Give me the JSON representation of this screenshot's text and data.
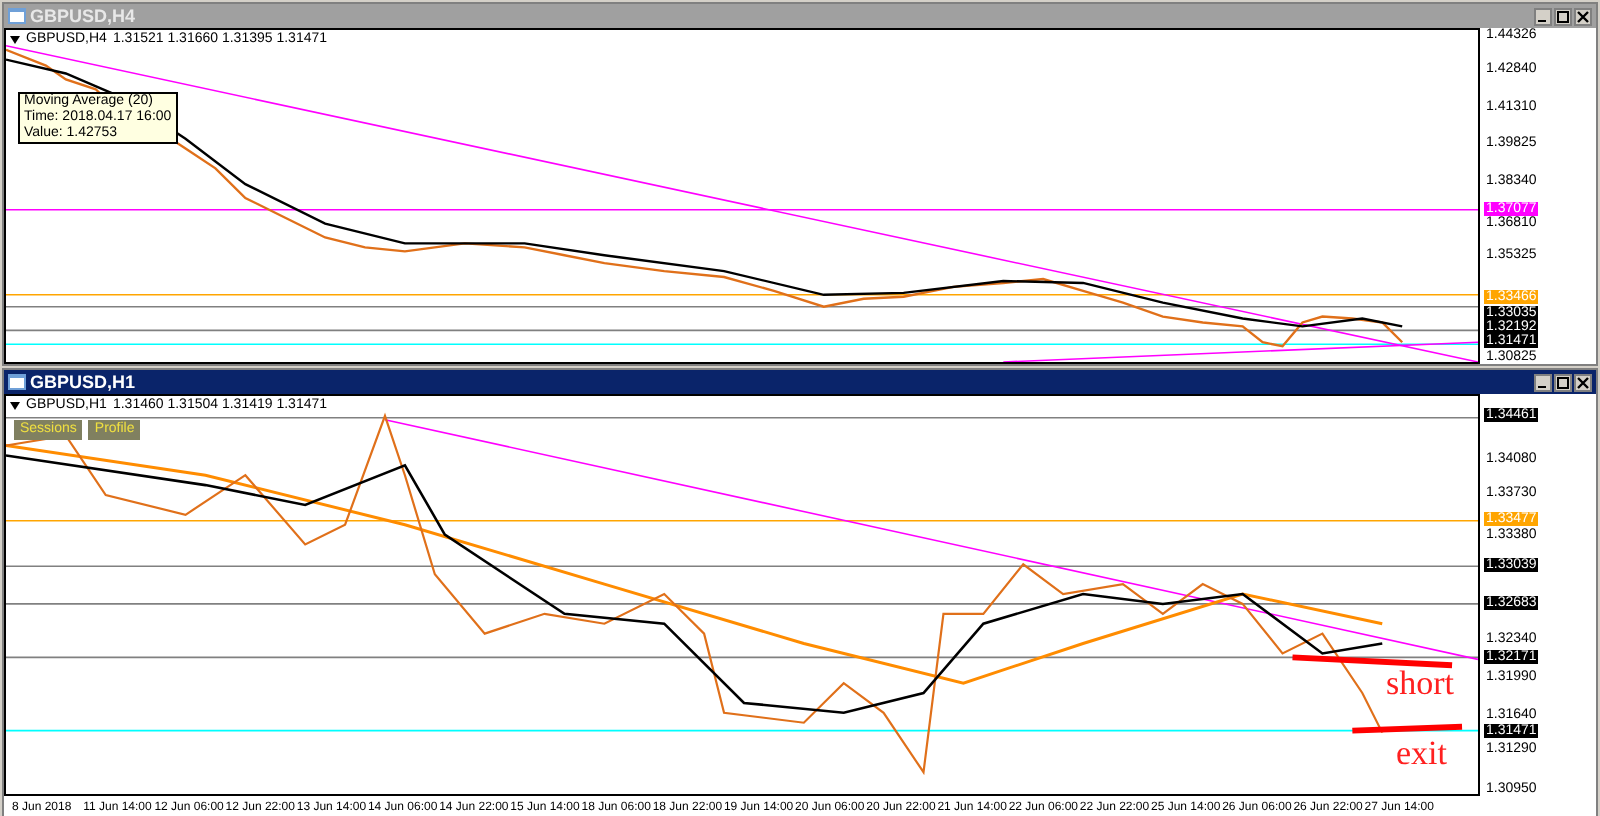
{
  "windows": [
    {
      "title": "GBPUSD,H4",
      "active": false,
      "header": {
        "symbol": "GBPUSD,H4",
        "prices": "1.31521 1.31660 1.31395 1.31471"
      },
      "tooltip": [
        "Moving Average (20)",
        "Time: 2018.04.17 16:00",
        "Value: 1.42753"
      ],
      "price_axis": [
        {
          "label": "1.44326",
          "kind": "tick"
        },
        {
          "label": "1.42840",
          "kind": "tick"
        },
        {
          "label": "1.41310",
          "kind": "tick"
        },
        {
          "label": "1.39825",
          "kind": "tick"
        },
        {
          "label": "1.38340",
          "kind": "tick"
        },
        {
          "label": "1.37077",
          "kind": "tag",
          "color": "#ff00ff"
        },
        {
          "label": "1.36810",
          "kind": "tick"
        },
        {
          "label": "1.35325",
          "kind": "tick"
        },
        {
          "label": "1.33466",
          "kind": "tag",
          "color": "#ffa500"
        },
        {
          "label": "1.33035",
          "kind": "tag",
          "color": "#000000"
        },
        {
          "label": "1.32192",
          "kind": "tag",
          "color": "#000000"
        },
        {
          "label": "1.31471",
          "kind": "tag",
          "color": "#000000"
        },
        {
          "label": "1.30825",
          "kind": "tick"
        }
      ]
    },
    {
      "title": "GBPUSD,H1",
      "active": true,
      "header": {
        "symbol": "GBPUSD,H1",
        "prices": "1.31460 1.31504 1.31419 1.31471"
      },
      "buttons": [
        "Sessions",
        "Profile"
      ],
      "annotations": [
        "short",
        "exit"
      ],
      "price_axis": [
        {
          "label": "1.34461",
          "kind": "tag",
          "color": "#000000"
        },
        {
          "label": "1.34080",
          "kind": "tick"
        },
        {
          "label": "1.33730",
          "kind": "tick"
        },
        {
          "label": "1.33477",
          "kind": "tag",
          "color": "#ffa500"
        },
        {
          "label": "1.33380",
          "kind": "tick"
        },
        {
          "label": "1.33039",
          "kind": "tag",
          "color": "#000000"
        },
        {
          "label": "1.32683",
          "kind": "tag",
          "color": "#000000"
        },
        {
          "label": "1.32340",
          "kind": "tick"
        },
        {
          "label": "1.32171",
          "kind": "tag",
          "color": "#000000"
        },
        {
          "label": "1.31990",
          "kind": "tick"
        },
        {
          "label": "1.31640",
          "kind": "tick"
        },
        {
          "label": "1.31471",
          "kind": "tag",
          "color": "#000000"
        },
        {
          "label": "1.31290",
          "kind": "tick"
        },
        {
          "label": "1.30950",
          "kind": "tick"
        }
      ],
      "time_axis": [
        "8 Jun 2018",
        "11 Jun 14:00",
        "12 Jun 06:00",
        "12 Jun 22:00",
        "13 Jun 14:00",
        "14 Jun 06:00",
        "14 Jun 22:00",
        "15 Jun 14:00",
        "18 Jun 06:00",
        "18 Jun 22:00",
        "19 Jun 14:00",
        "20 Jun 06:00",
        "20 Jun 22:00",
        "21 Jun 14:00",
        "22 Jun 06:00",
        "22 Jun 22:00",
        "25 Jun 14:00",
        "26 Jun 06:00",
        "26 Jun 22:00",
        "27 Jun 14:00"
      ]
    }
  ]
}
